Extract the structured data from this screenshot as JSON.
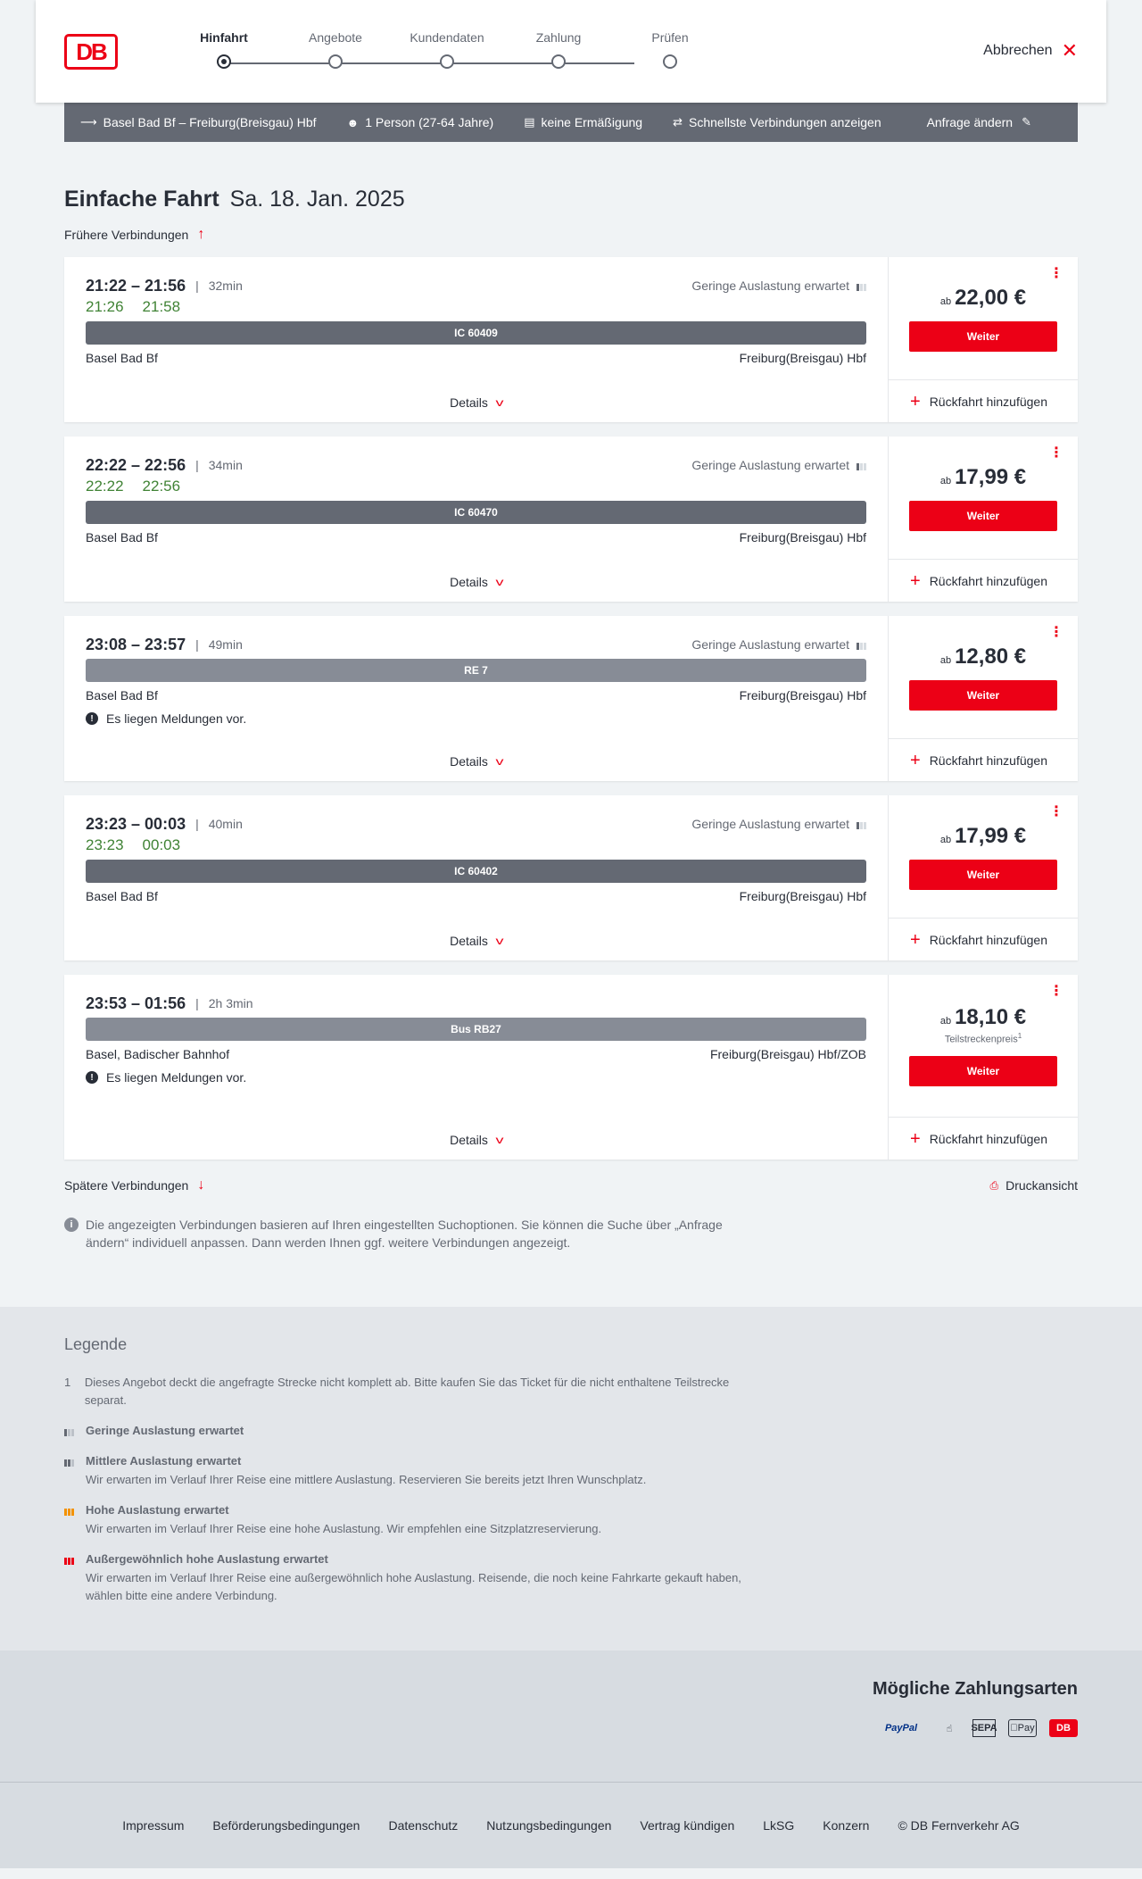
{
  "logo": "DB",
  "stepper": {
    "steps": [
      {
        "label": "Hinfahrt",
        "active": true
      },
      {
        "label": "Angebote",
        "active": false
      },
      {
        "label": "Kundendaten",
        "active": false
      },
      {
        "label": "Zahlung",
        "active": false
      },
      {
        "label": "Prüfen",
        "active": false
      }
    ]
  },
  "header": {
    "cancel_label": "Abbrechen"
  },
  "summary": {
    "route": "Basel Bad Bf – Freiburg(Breisgau) Hbf",
    "travellers": "1 Person (27-64 Jahre)",
    "discount": "keine Ermäßigung",
    "option": "Schnellste Verbindungen anzeigen",
    "change": "Anfrage ändern"
  },
  "title": {
    "main": "Einfache Fahrt",
    "date": "Sa. 18. Jan. 2025"
  },
  "earlier_label": "Frühere Verbindungen",
  "later_label": "Spätere Verbindungen",
  "print_label": "Druckansicht",
  "labels": {
    "details": "Details",
    "weiter": "Weiter",
    "add_return": "Rückfahrt hinzufügen",
    "price_prefix": "ab",
    "message": "Es liegen Meldungen vor."
  },
  "connections": [
    {
      "times": "21:22 – 21:56",
      "duration": "32min",
      "load": "Geringe Auslastung erwartet",
      "realtime": [
        "21:26",
        "21:58"
      ],
      "train": "IC 60409",
      "train_style": "dark",
      "from": "Basel Bad Bf",
      "to": "Freiburg(Breisgau) Hbf",
      "has_message": false,
      "price": "22,00 €",
      "partial_price": ""
    },
    {
      "times": "22:22 – 22:56",
      "duration": "34min",
      "load": "Geringe Auslastung erwartet",
      "realtime": [
        "22:22",
        "22:56"
      ],
      "train": "IC 60470",
      "train_style": "dark",
      "from": "Basel Bad Bf",
      "to": "Freiburg(Breisgau) Hbf",
      "has_message": false,
      "price": "17,99 €",
      "partial_price": ""
    },
    {
      "times": "23:08 – 23:57",
      "duration": "49min",
      "load": "Geringe Auslastung erwartet",
      "realtime": [],
      "train": "RE 7",
      "train_style": "light",
      "from": "Basel Bad Bf",
      "to": "Freiburg(Breisgau) Hbf",
      "has_message": true,
      "price": "12,80 €",
      "partial_price": ""
    },
    {
      "times": "23:23 – 00:03",
      "duration": "40min",
      "load": "Geringe Auslastung erwartet",
      "realtime": [
        "23:23",
        "00:03"
      ],
      "train": "IC 60402",
      "train_style": "dark",
      "from": "Basel Bad Bf",
      "to": "Freiburg(Breisgau) Hbf",
      "has_message": false,
      "price": "17,99 €",
      "partial_price": ""
    },
    {
      "times": "23:53 – 01:56",
      "duration": "2h 3min",
      "load": "",
      "realtime": [],
      "train": "Bus RB27",
      "train_style": "light",
      "from": "Basel, Badischer Bahnhof",
      "to": "Freiburg(Breisgau) Hbf/ZOB",
      "has_message": true,
      "price": "18,10 €",
      "partial_price": "Teilstreckenpreis",
      "partial_sup": "1"
    }
  ],
  "info_text": "Die angezeigten Verbindungen basieren auf Ihren eingestellten Suchoptionen. Sie können die Suche über „Anfrage ändern“ individuell anpassen. Dann werden Ihnen ggf. weitere Verbindungen angezeigt.",
  "legend": {
    "title": "Legende",
    "note_number": "1",
    "note": "Dieses Angebot deckt die angefragte Strecke nicht komplett ab. Bitte kaufen Sie das Ticket für die nicht enthaltene Teilstrecke separat.",
    "items": [
      {
        "title": "Geringe Auslastung erwartet",
        "desc": ""
      },
      {
        "title": "Mittlere Auslastung erwartet",
        "desc": "Wir erwarten im Verlauf Ihrer Reise eine mittlere Auslastung. Reservieren Sie bereits jetzt Ihren Wunschplatz."
      },
      {
        "title": "Hohe Auslastung erwartet",
        "desc": "Wir erwarten im Verlauf Ihrer Reise eine hohe Auslastung. Wir empfehlen eine Sitzplatzreservierung."
      },
      {
        "title": "Außergewöhnlich hohe Auslastung erwartet",
        "desc": "Wir erwarten im Verlauf Ihrer Reise eine außergewöhnlich hohe Auslastung. Reisende, die noch keine Fahrkarte gekauft haben, wählen bitte eine andere Verbindung."
      }
    ]
  },
  "payment": {
    "title": "Mögliche Zahlungsarten",
    "methods": [
      "PayPal",
      "credit-card-icon",
      "SEPA",
      "Pay",
      "DB"
    ]
  },
  "footer": {
    "links": [
      "Impressum",
      "Beförderungsbedingungen",
      "Datenschutz",
      "Nutzungsbedingungen",
      "Vertrag kündigen",
      "LkSG",
      "Konzern",
      "© DB Fernverkehr AG"
    ]
  },
  "colors": {
    "brand_red": "#ec0016",
    "realtime_green": "#408335",
    "bar_dark": "#646973",
    "bar_light": "#878c96"
  }
}
